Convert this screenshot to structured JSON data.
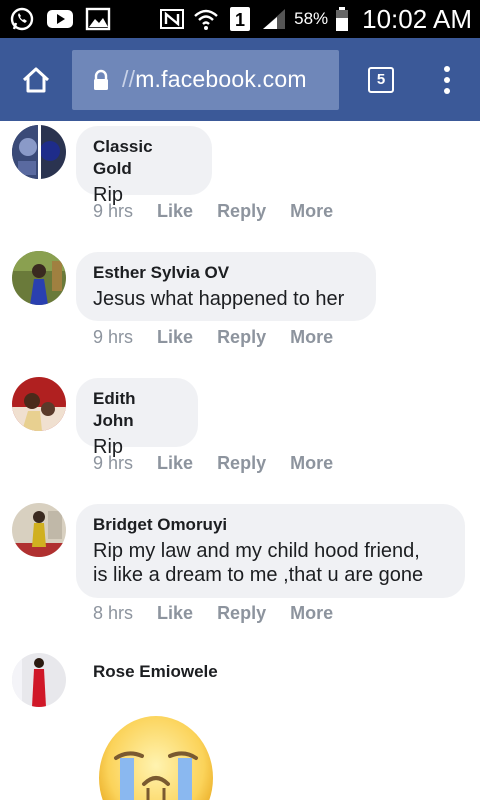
{
  "status_bar": {
    "battery_percent": "58%",
    "sim_slot": "1",
    "time": "10:02 AM"
  },
  "browser": {
    "url_prefix": "//",
    "url_domain": "m.facebook.com",
    "tab_count": "5"
  },
  "comments": [
    {
      "name": "Classic Gold",
      "text": "Rip",
      "time": "9 hrs",
      "like": "Like",
      "reply": "Reply",
      "more": "More"
    },
    {
      "name": "Esther Sylvia OV",
      "text": "Jesus what happened to her",
      "time": "9 hrs",
      "like": "Like",
      "reply": "Reply",
      "more": "More"
    },
    {
      "name": "Edith John",
      "text": "Rip",
      "time": "9 hrs",
      "like": "Like",
      "reply": "Reply",
      "more": "More"
    },
    {
      "name": "Bridget Omoruyi",
      "text_line1": "Rip my law and my child hood friend,",
      "text_line2": "is like a dream to me ,that u are gone",
      "time": "8 hrs",
      "like": "Like",
      "reply": "Reply",
      "more": "More"
    },
    {
      "name": "Rose Emiowele"
    }
  ],
  "colors": {
    "facebook_blue": "#3b5998",
    "url_box": "#6f87b9",
    "bubble": "#f0f1f4",
    "meta_grey": "#8d949e"
  },
  "icons": [
    "whatsapp-icon",
    "youtube-icon",
    "gallery-icon",
    "nfc-icon",
    "vibrate-icon",
    "wifi-icon",
    "signal-icon",
    "battery-icon",
    "home-icon",
    "lock-icon",
    "tabs-icon",
    "overflow-menu-icon",
    "crying-emoji"
  ]
}
